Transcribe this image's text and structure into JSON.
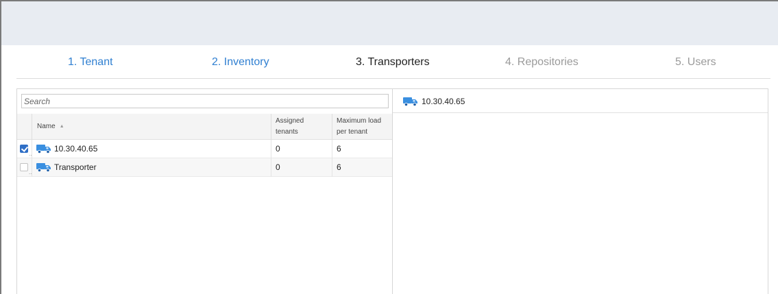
{
  "wizard": {
    "steps": [
      {
        "label": "1. Tenant",
        "state": "done"
      },
      {
        "label": "2. Inventory",
        "state": "done"
      },
      {
        "label": "3. Transporters",
        "state": "active"
      },
      {
        "label": "4. Repositories",
        "state": "todo"
      },
      {
        "label": "5. Users",
        "state": "todo"
      }
    ]
  },
  "search": {
    "placeholder": "Search"
  },
  "table": {
    "headers": {
      "name": "Name",
      "assigned_line1": "Assigned",
      "assigned_line2": "tenants",
      "maxload_line1": "Maximum load",
      "maxload_line2": "per tenant"
    },
    "rows": [
      {
        "name": "10.30.40.65",
        "assigned": "0",
        "max_load": "6",
        "checked": true
      },
      {
        "name": "Transporter",
        "assigned": "0",
        "max_load": "6",
        "checked": false
      }
    ]
  },
  "details": {
    "title": "10.30.40.65"
  },
  "colors": {
    "accent": "#2f7fd1",
    "icon_blue": "#3a8fe0",
    "checkbox": "#2f6fc6"
  },
  "icons": {
    "transporter": "truck-icon",
    "sort": "sort-ascending-icon",
    "checkbox": "checkbox-icon"
  }
}
